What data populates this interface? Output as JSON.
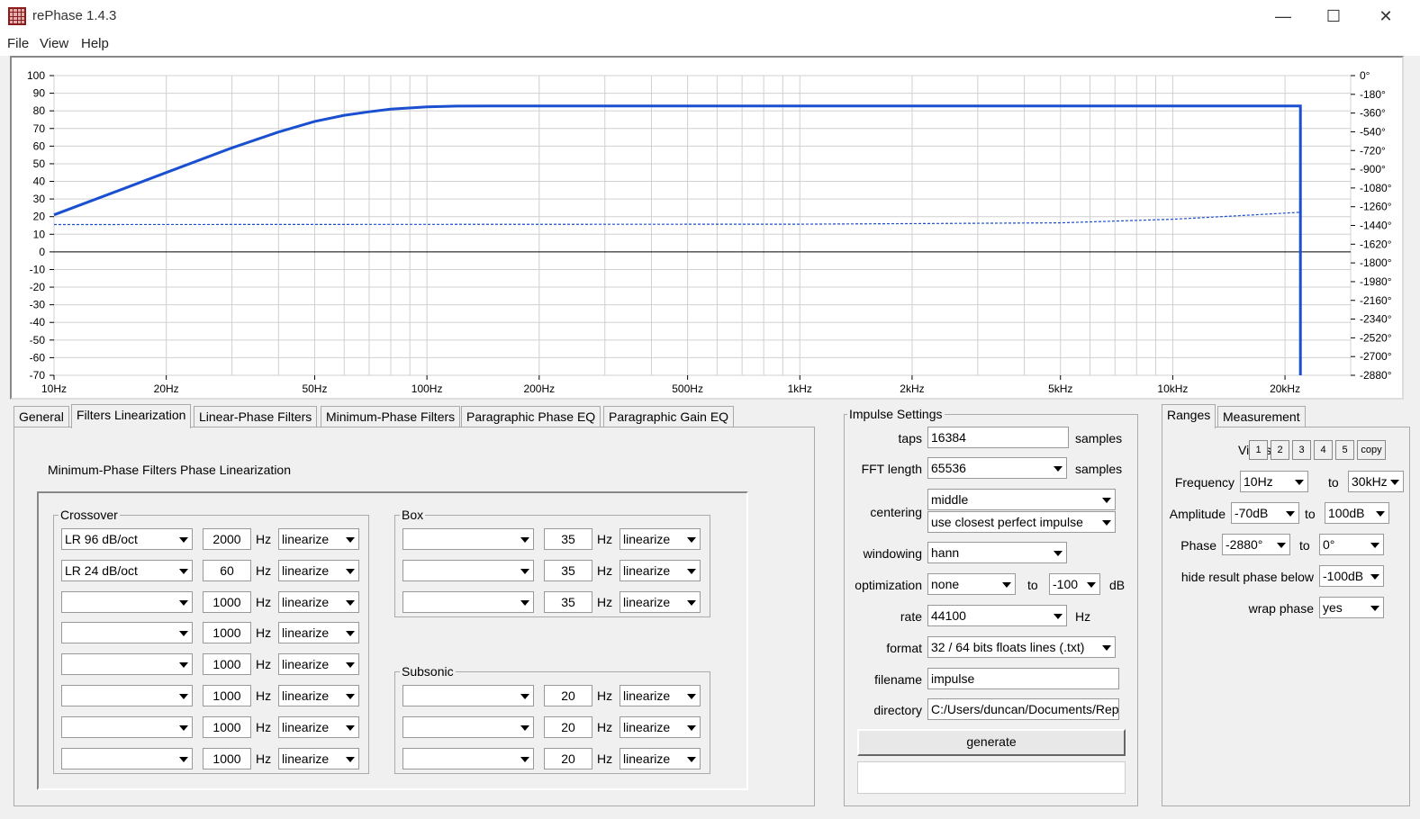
{
  "window": {
    "title": "rePhase 1.4.3",
    "minimize": "—",
    "maximize": "☐",
    "close": "✕"
  },
  "menu": {
    "file": "File",
    "view": "View",
    "help": "Help"
  },
  "chart_data": {
    "type": "line",
    "x_ticks": [
      "10Hz",
      "20Hz",
      "50Hz",
      "100Hz",
      "200Hz",
      "500Hz",
      "1kHz",
      "2kHz",
      "5kHz",
      "10kHz",
      "20kHz"
    ],
    "x_tick_values": [
      10,
      20,
      50,
      100,
      200,
      500,
      1000,
      2000,
      5000,
      10000,
      20000
    ],
    "xlim": [
      10,
      30000
    ],
    "x_scale": "log",
    "y_left_ticks": [
      "100",
      "90",
      "80",
      "70",
      "60",
      "50",
      "40",
      "30",
      "20",
      "10",
      "0",
      "-10",
      "-20",
      "-30",
      "-40",
      "-50",
      "-60",
      "-70"
    ],
    "ylim_left": [
      -70,
      100
    ],
    "y_right_ticks": [
      "0°",
      "-180°",
      "-360°",
      "-540°",
      "-720°",
      "-900°",
      "-1080°",
      "-1260°",
      "-1440°",
      "-1620°",
      "-1800°",
      "-1980°",
      "-2160°",
      "-2340°",
      "-2520°",
      "-2700°",
      "-2880°"
    ],
    "ylim_right": [
      -2880,
      0
    ],
    "grid": true,
    "series": [
      {
        "style": "solid",
        "color": "#1a4fd0",
        "x": [
          10,
          15,
          20,
          30,
          40,
          50,
          60,
          70,
          80,
          100,
          120,
          150,
          200,
          500,
          1000,
          5000,
          10000,
          20000,
          22000,
          22000
        ],
        "y": [
          21,
          35,
          45,
          59,
          68,
          74,
          77.5,
          79.5,
          81,
          82.3,
          82.7,
          82.8,
          82.8,
          82.8,
          82.8,
          82.8,
          82.8,
          82.8,
          82.8,
          -70
        ]
      },
      {
        "style": "dotted",
        "color": "#1a4fd0",
        "x": [
          10,
          100,
          1000,
          5000,
          10000,
          15000,
          20000,
          22000
        ],
        "y": [
          15.5,
          15.6,
          15.7,
          16.5,
          18.5,
          20.5,
          22,
          22.5
        ]
      }
    ]
  },
  "tabs": [
    "General",
    "Filters Linearization",
    "Linear-Phase Filters",
    "Minimum-Phase Filters",
    "Paragraphic Phase EQ",
    "Paragraphic Gain EQ"
  ],
  "linearization": {
    "heading": "Minimum-Phase Filters Phase Linearization",
    "hz": "Hz",
    "crossover": {
      "title": "Crossover",
      "rows": [
        {
          "type": "LR  96 dB/oct",
          "freq": "2000",
          "mode": "linearize"
        },
        {
          "type": "LR  24 dB/oct",
          "freq": "60",
          "mode": "linearize"
        },
        {
          "type": "",
          "freq": "1000",
          "mode": "linearize"
        },
        {
          "type": "",
          "freq": "1000",
          "mode": "linearize"
        },
        {
          "type": "",
          "freq": "1000",
          "mode": "linearize"
        },
        {
          "type": "",
          "freq": "1000",
          "mode": "linearize"
        },
        {
          "type": "",
          "freq": "1000",
          "mode": "linearize"
        },
        {
          "type": "",
          "freq": "1000",
          "mode": "linearize"
        }
      ]
    },
    "box": {
      "title": "Box",
      "rows": [
        {
          "type": "",
          "freq": "35",
          "mode": "linearize"
        },
        {
          "type": "",
          "freq": "35",
          "mode": "linearize"
        },
        {
          "type": "",
          "freq": "35",
          "mode": "linearize"
        }
      ]
    },
    "subsonic": {
      "title": "Subsonic",
      "rows": [
        {
          "type": "",
          "freq": "20",
          "mode": "linearize"
        },
        {
          "type": "",
          "freq": "20",
          "mode": "linearize"
        },
        {
          "type": "",
          "freq": "20",
          "mode": "linearize"
        }
      ]
    }
  },
  "impulse": {
    "title": "Impulse Settings",
    "taps_label": "taps",
    "taps": "16384",
    "samples": "samples",
    "fft_label": "FFT length",
    "fft": "65536",
    "centering_label": "centering",
    "centering": "middle",
    "centering2": "use closest perfect impulse",
    "windowing_label": "windowing",
    "windowing": "hann",
    "optimization_label": "optimization",
    "optimization": "none",
    "to": "to",
    "opt_db": "-100",
    "db": "dB",
    "rate_label": "rate",
    "rate": "44100",
    "hz": "Hz",
    "format_label": "format",
    "format": "32 / 64 bits floats lines (.txt)",
    "filename_label": "filename",
    "filename": "impulse",
    "directory_label": "directory",
    "directory": "C:/Users/duncan/Documents/Rep",
    "generate": "generate",
    "status": ""
  },
  "ranges": {
    "tab_ranges": "Ranges",
    "tab_measurement": "Measurement",
    "views_label": "Views",
    "views": [
      "1",
      "2",
      "3",
      "4",
      "5"
    ],
    "copy": "copy",
    "frequency_label": "Frequency",
    "freq_from": "10Hz",
    "to": "to",
    "freq_to": "30kHz",
    "amplitude_label": "Amplitude",
    "amp_from": "-70dB",
    "amp_to": "100dB",
    "phase_label": "Phase",
    "phase_from": "-2880°",
    "phase_to": "0°",
    "hide_label": "hide result phase below",
    "hide_value": "-100dB",
    "wrap_label": "wrap phase",
    "wrap_value": "yes"
  }
}
